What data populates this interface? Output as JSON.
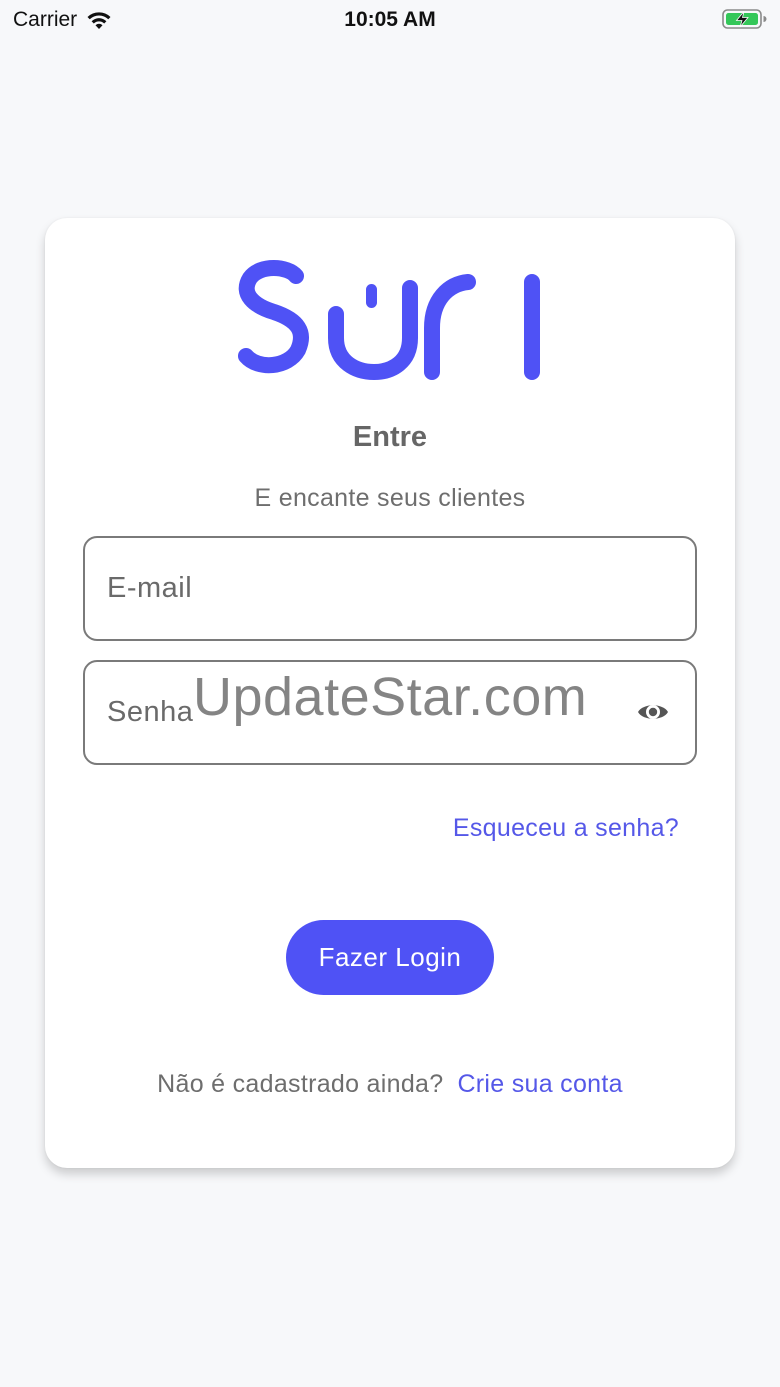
{
  "status_bar": {
    "carrier": "Carrier",
    "time": "10:05 AM",
    "icons": [
      "wifi-icon",
      "battery-charging-icon"
    ]
  },
  "login": {
    "logo_text": "suri",
    "title": "Entre",
    "subtitle": "E encante seus clientes",
    "email": {
      "placeholder": "E-mail",
      "value": ""
    },
    "password": {
      "placeholder": "Senha",
      "value": "",
      "toggle_icon": "eye-icon"
    },
    "forgot_link": "Esqueceu a senha?",
    "login_button": "Fazer Login",
    "signup_prompt": "Não é cadastrado ainda?",
    "signup_link": "Crie sua conta"
  },
  "watermark": "UpdateStar.com",
  "colors": {
    "brand": "#4f52f5",
    "link": "#5558e8",
    "background": "#f7f8fa",
    "card": "#ffffff"
  }
}
